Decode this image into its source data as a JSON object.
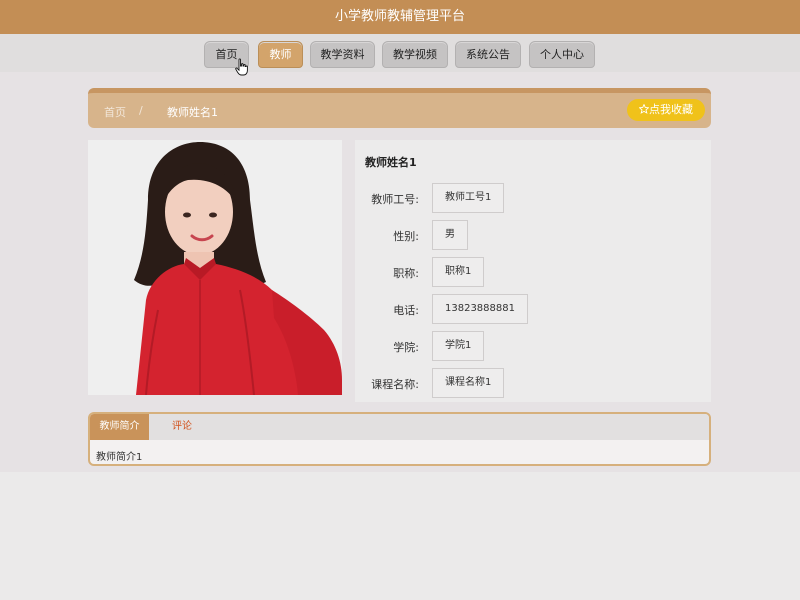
{
  "header": {
    "title": "小学教师教辅管理平台"
  },
  "nav": {
    "items": [
      {
        "label": "首页",
        "active": false
      },
      {
        "label": "教师",
        "active": true
      },
      {
        "label": "教学资料",
        "active": false
      },
      {
        "label": "教学视频",
        "active": false
      },
      {
        "label": "系统公告",
        "active": false
      },
      {
        "label": "个人中心",
        "active": false
      }
    ]
  },
  "breadcrumb": {
    "home": "首页",
    "separator": "/",
    "current": "教师姓名1"
  },
  "favorite": {
    "label": "点我收藏",
    "icon": "star-outline-icon"
  },
  "teacher": {
    "name": "教师姓名1",
    "fields": [
      {
        "label": "教师工号:",
        "value": "教师工号1"
      },
      {
        "label": "性别:",
        "value": "男"
      },
      {
        "label": "职称:",
        "value": "职称1"
      },
      {
        "label": "电话:",
        "value": "13823888881"
      },
      {
        "label": "学院:",
        "value": "学院1"
      },
      {
        "label": "课程名称:",
        "value": "课程名称1"
      }
    ]
  },
  "tabs": {
    "items": [
      {
        "label": "教师简介",
        "active": true
      },
      {
        "label": "评论",
        "active": false
      }
    ],
    "content": "教师简介1"
  },
  "colors": {
    "brand": "#c38e55",
    "active_nav": "#d3a46b",
    "favorite": "#f0c21a",
    "comment_tab": "#d2531e"
  }
}
